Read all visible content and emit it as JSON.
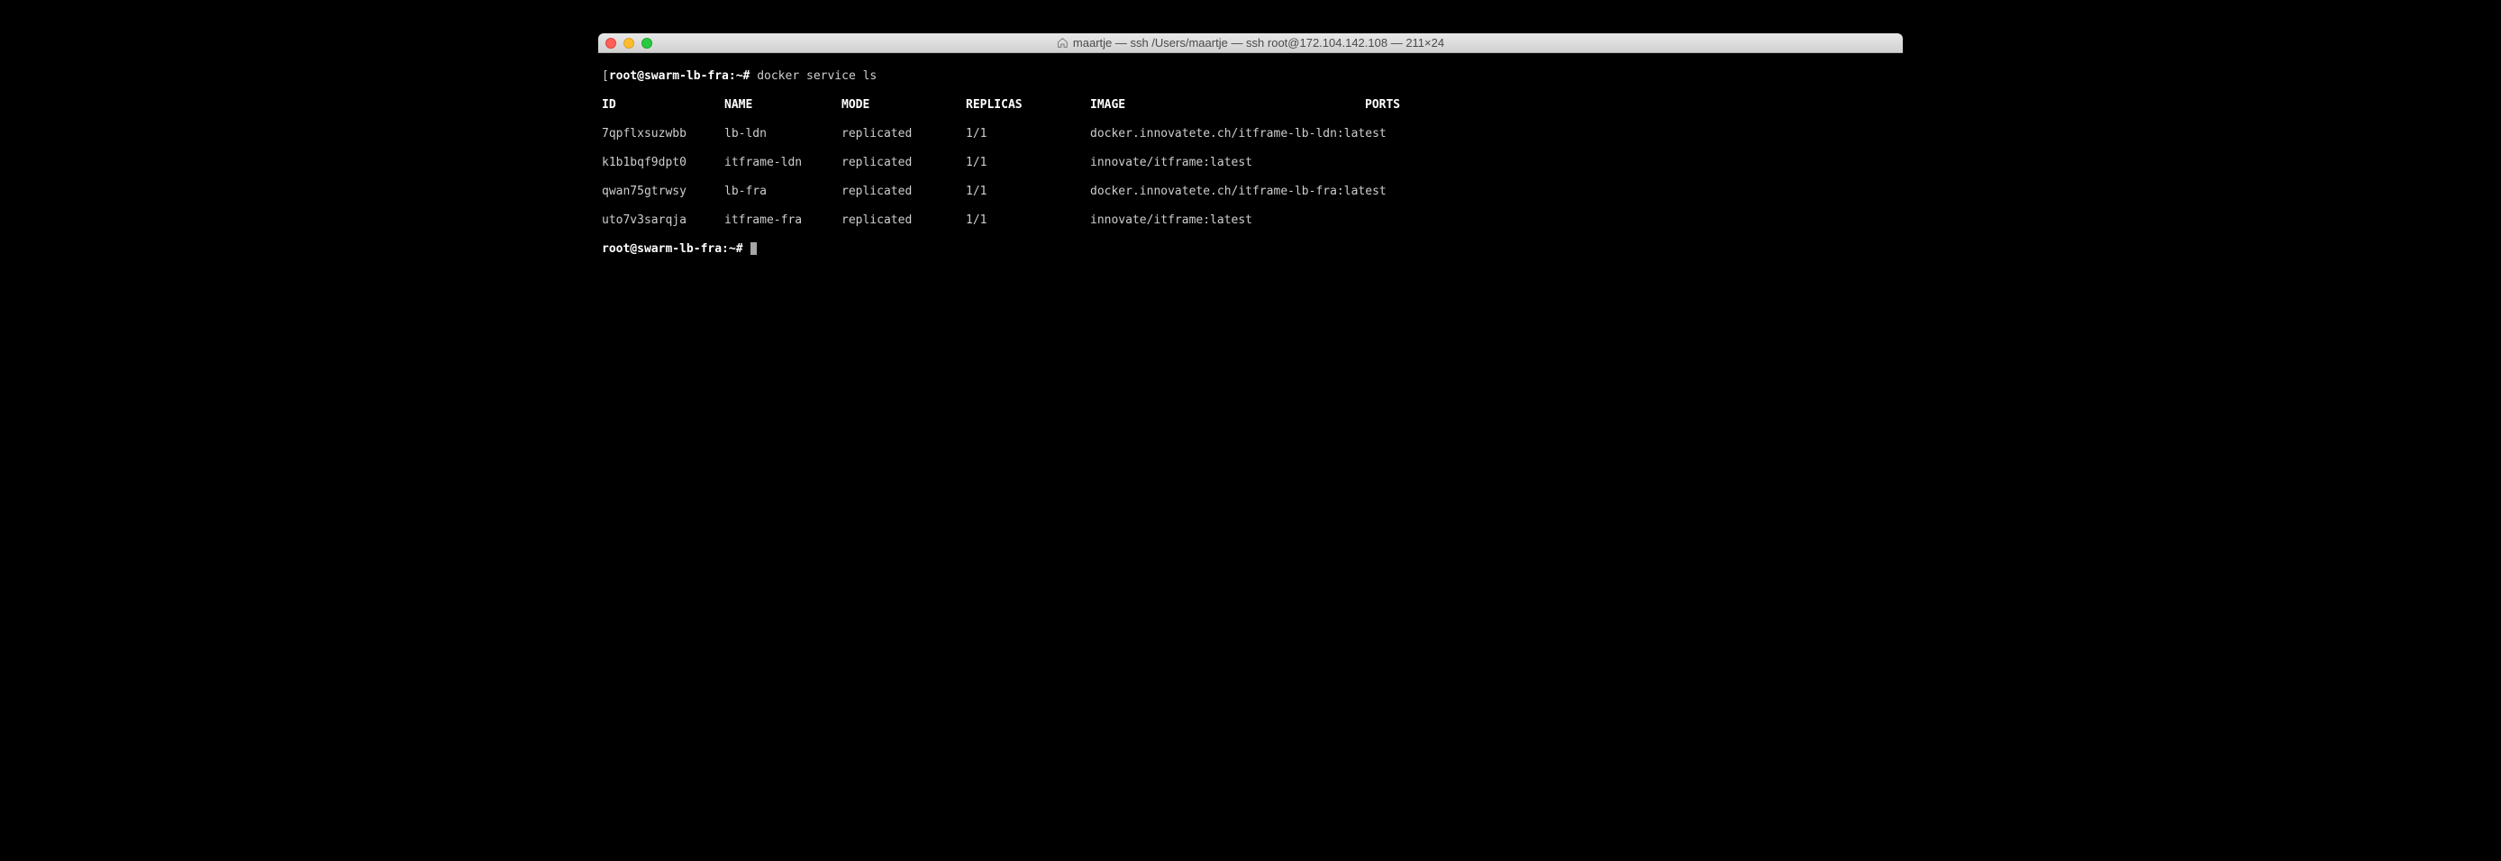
{
  "window": {
    "title": "maartje — ssh  /Users/maartje — ssh root@172.104.142.108 — 211×24"
  },
  "terminal": {
    "prompt_prefix": "[",
    "prompt_user_host": "root@swarm-lb-fra:~#",
    "prompt_suffix_bracket": "]",
    "command": "docker service ls",
    "headers": {
      "id": "ID",
      "name": "NAME",
      "mode": "MODE",
      "replicas": "REPLICAS",
      "image": "IMAGE",
      "ports": "PORTS"
    },
    "rows": [
      {
        "id": "7qpflxsuzwbb",
        "name": "lb-ldn",
        "mode": "replicated",
        "replicas": "1/1",
        "image": "docker.innovatete.ch/itframe-lb-ldn:latest",
        "ports": ""
      },
      {
        "id": "k1b1bqf9dpt0",
        "name": "itframe-ldn",
        "mode": "replicated",
        "replicas": "1/1",
        "image": "innovate/itframe:latest",
        "ports": ""
      },
      {
        "id": "qwan75gtrwsy",
        "name": "lb-fra",
        "mode": "replicated",
        "replicas": "1/1",
        "image": "docker.innovatete.ch/itframe-lb-fra:latest",
        "ports": ""
      },
      {
        "id": "uto7v3sarqja",
        "name": "itframe-fra",
        "mode": "replicated",
        "replicas": "1/1",
        "image": "innovate/itframe:latest",
        "ports": ""
      }
    ],
    "final_prompt": "root@swarm-lb-fra:~#"
  }
}
